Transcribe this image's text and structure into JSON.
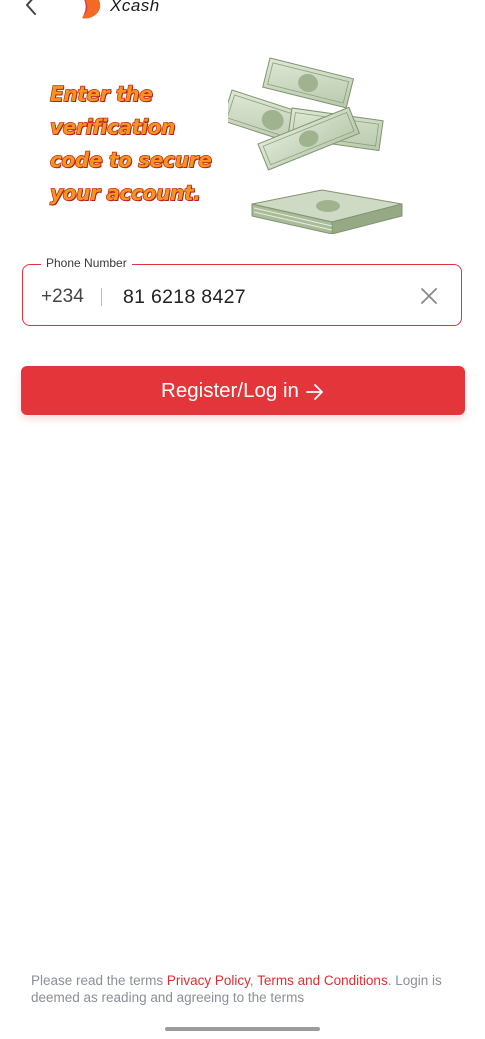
{
  "header": {
    "app_name": "Xcash"
  },
  "banner": {
    "lines": [
      "Enter the",
      "verification",
      "code to secure",
      "your account."
    ]
  },
  "phone_field": {
    "label": "Phone Number",
    "country_code": "+234",
    "value": "81 6218 8427"
  },
  "submit_button": {
    "label": "Register/Log in"
  },
  "terms": {
    "prefix": "Please read the terms ",
    "privacy_link": "Privacy Policy",
    "separator": ", ",
    "terms_link": "Terms and Conditions",
    "suffix": ". Login is deemed as reading and agreeing to the terms"
  },
  "colors": {
    "accent": "#e3353a",
    "banner_fill": "#f7941d",
    "banner_outline": "#c0271c",
    "link": "#d8302f",
    "muted_text": "#8a8f98"
  },
  "icons": {
    "back": "chevron-left-icon",
    "logo": "xcash-logo",
    "clear": "close-icon",
    "arrow": "arrow-right-icon"
  }
}
